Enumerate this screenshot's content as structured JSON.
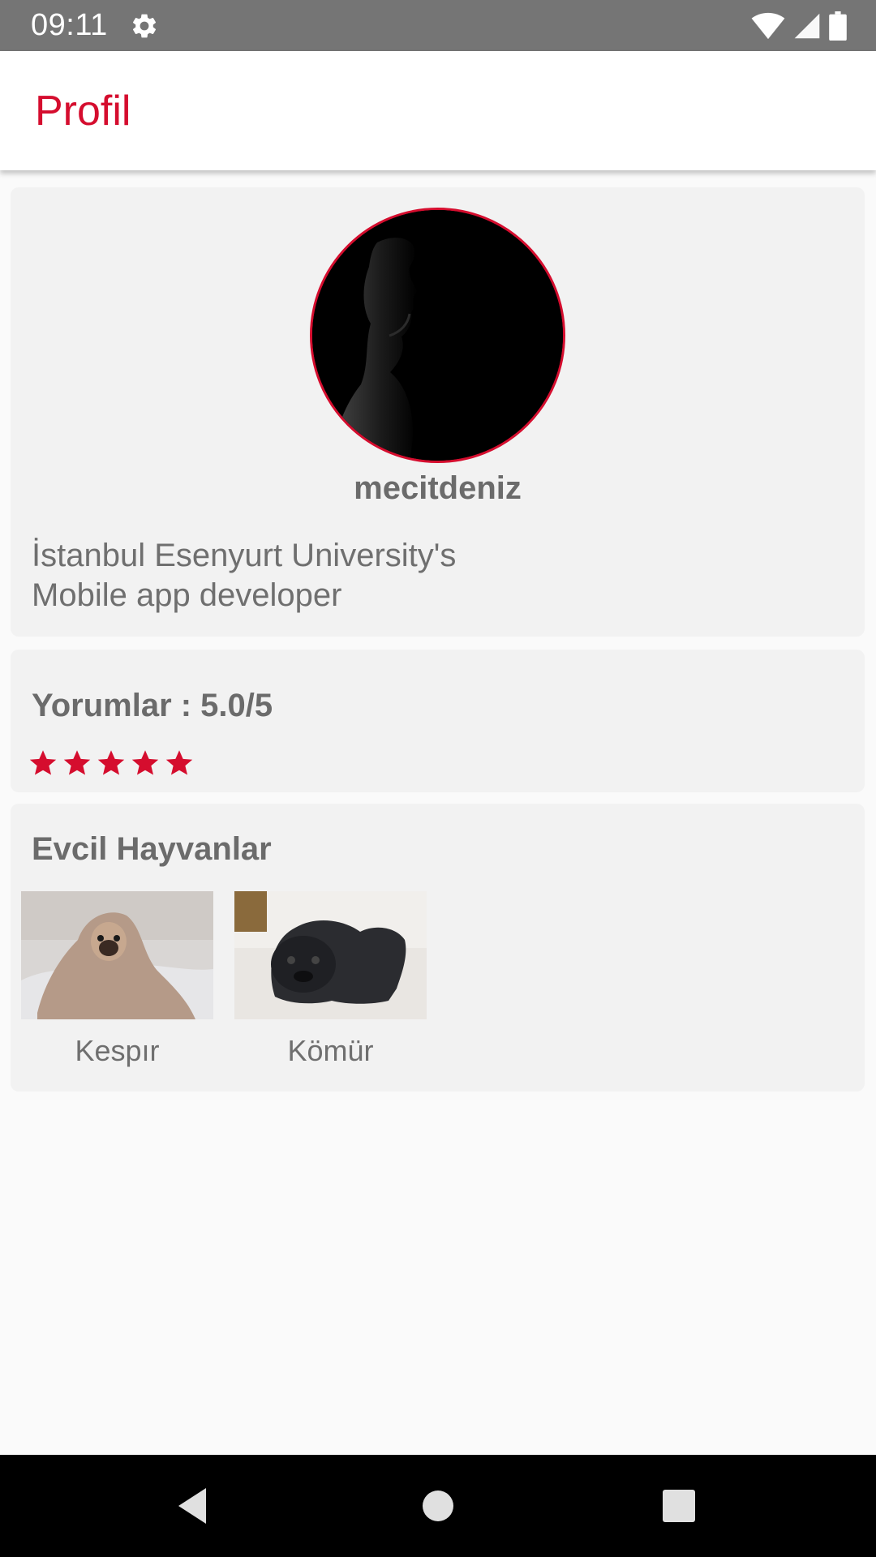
{
  "status_bar": {
    "time": "09:11",
    "icons": [
      "settings-icon",
      "wifi-icon",
      "signal-icon",
      "battery-icon"
    ]
  },
  "app_bar": {
    "title": "Profil"
  },
  "profile": {
    "username": "mecitdeniz",
    "bio_line1": "İstanbul Esenyurt University's",
    "bio_line2": "Mobile app developer"
  },
  "reviews": {
    "label": "Yorumlar : 5.0/5",
    "rating": 5,
    "max_rating": 5
  },
  "pets": {
    "label": "Evcil Hayvanlar",
    "items": [
      {
        "name": "Kespır"
      },
      {
        "name": "Kömür"
      }
    ]
  },
  "nav": {
    "icons": [
      "back-icon",
      "home-icon",
      "recent-apps-icon"
    ]
  },
  "colors": {
    "accent": "#d50d2e",
    "status_bar": "#757575",
    "card": "#f2f2f2",
    "text": "#6b6b6b"
  }
}
